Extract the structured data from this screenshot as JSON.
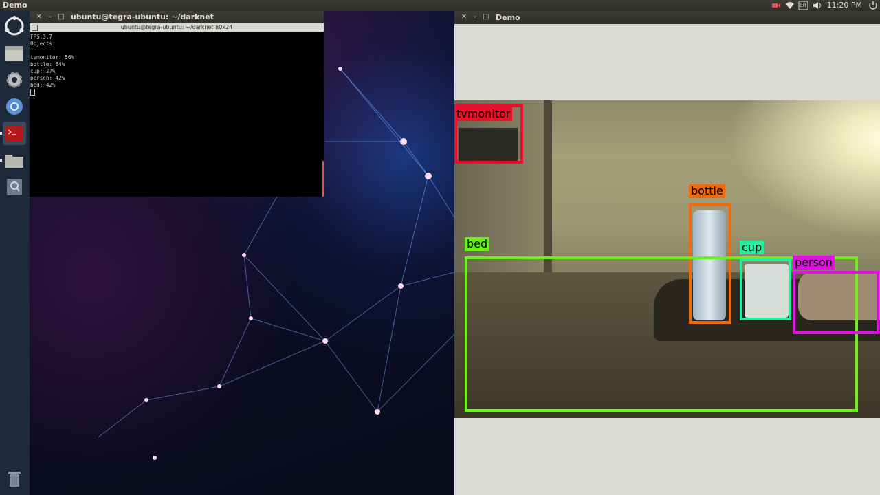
{
  "top_panel": {
    "app_title": "Demo",
    "clock": "11:20 PM",
    "tray_icons": [
      "camera-record-icon",
      "wifi-icon",
      "keyboard-layout-icon",
      "volume-icon",
      "power-icon"
    ],
    "keyboard_layout": "En"
  },
  "launcher": {
    "items": [
      {
        "name": "ubuntu-dash-icon"
      },
      {
        "name": "files-icon"
      },
      {
        "name": "settings-gear-icon"
      },
      {
        "name": "chromium-browser-icon"
      },
      {
        "name": "terminal-app-icon"
      },
      {
        "name": "folder-icon"
      },
      {
        "name": "disk-search-icon"
      },
      {
        "name": "trash-icon"
      }
    ]
  },
  "terminal": {
    "window_title": "ubuntu@tegra-ubuntu: ~/darknet",
    "tab_title": "ubuntu@tegra-ubuntu: ~/darknet 80x24",
    "lines": [
      "FPS:3.7",
      "Objects:",
      "",
      "tvmonitor: 56%",
      "bottle: 84%",
      "cup: 27%",
      "person: 42%",
      "bed: 42%"
    ]
  },
  "demo_window": {
    "title": "Demo",
    "detections": [
      {
        "label": "tvmonitor",
        "color": "#e8102a"
      },
      {
        "label": "bottle",
        "color": "#f06a10"
      },
      {
        "label": "bed",
        "color": "#6af01a"
      },
      {
        "label": "cup",
        "color": "#20f0a0"
      },
      {
        "label": "person",
        "color": "#e010e0"
      }
    ]
  },
  "colors": {
    "panel_bg": "#3c3b37",
    "launcher_bg": "#1e2a3a",
    "terminal_bg": "#000000",
    "demo_bg": "#dadad6"
  }
}
